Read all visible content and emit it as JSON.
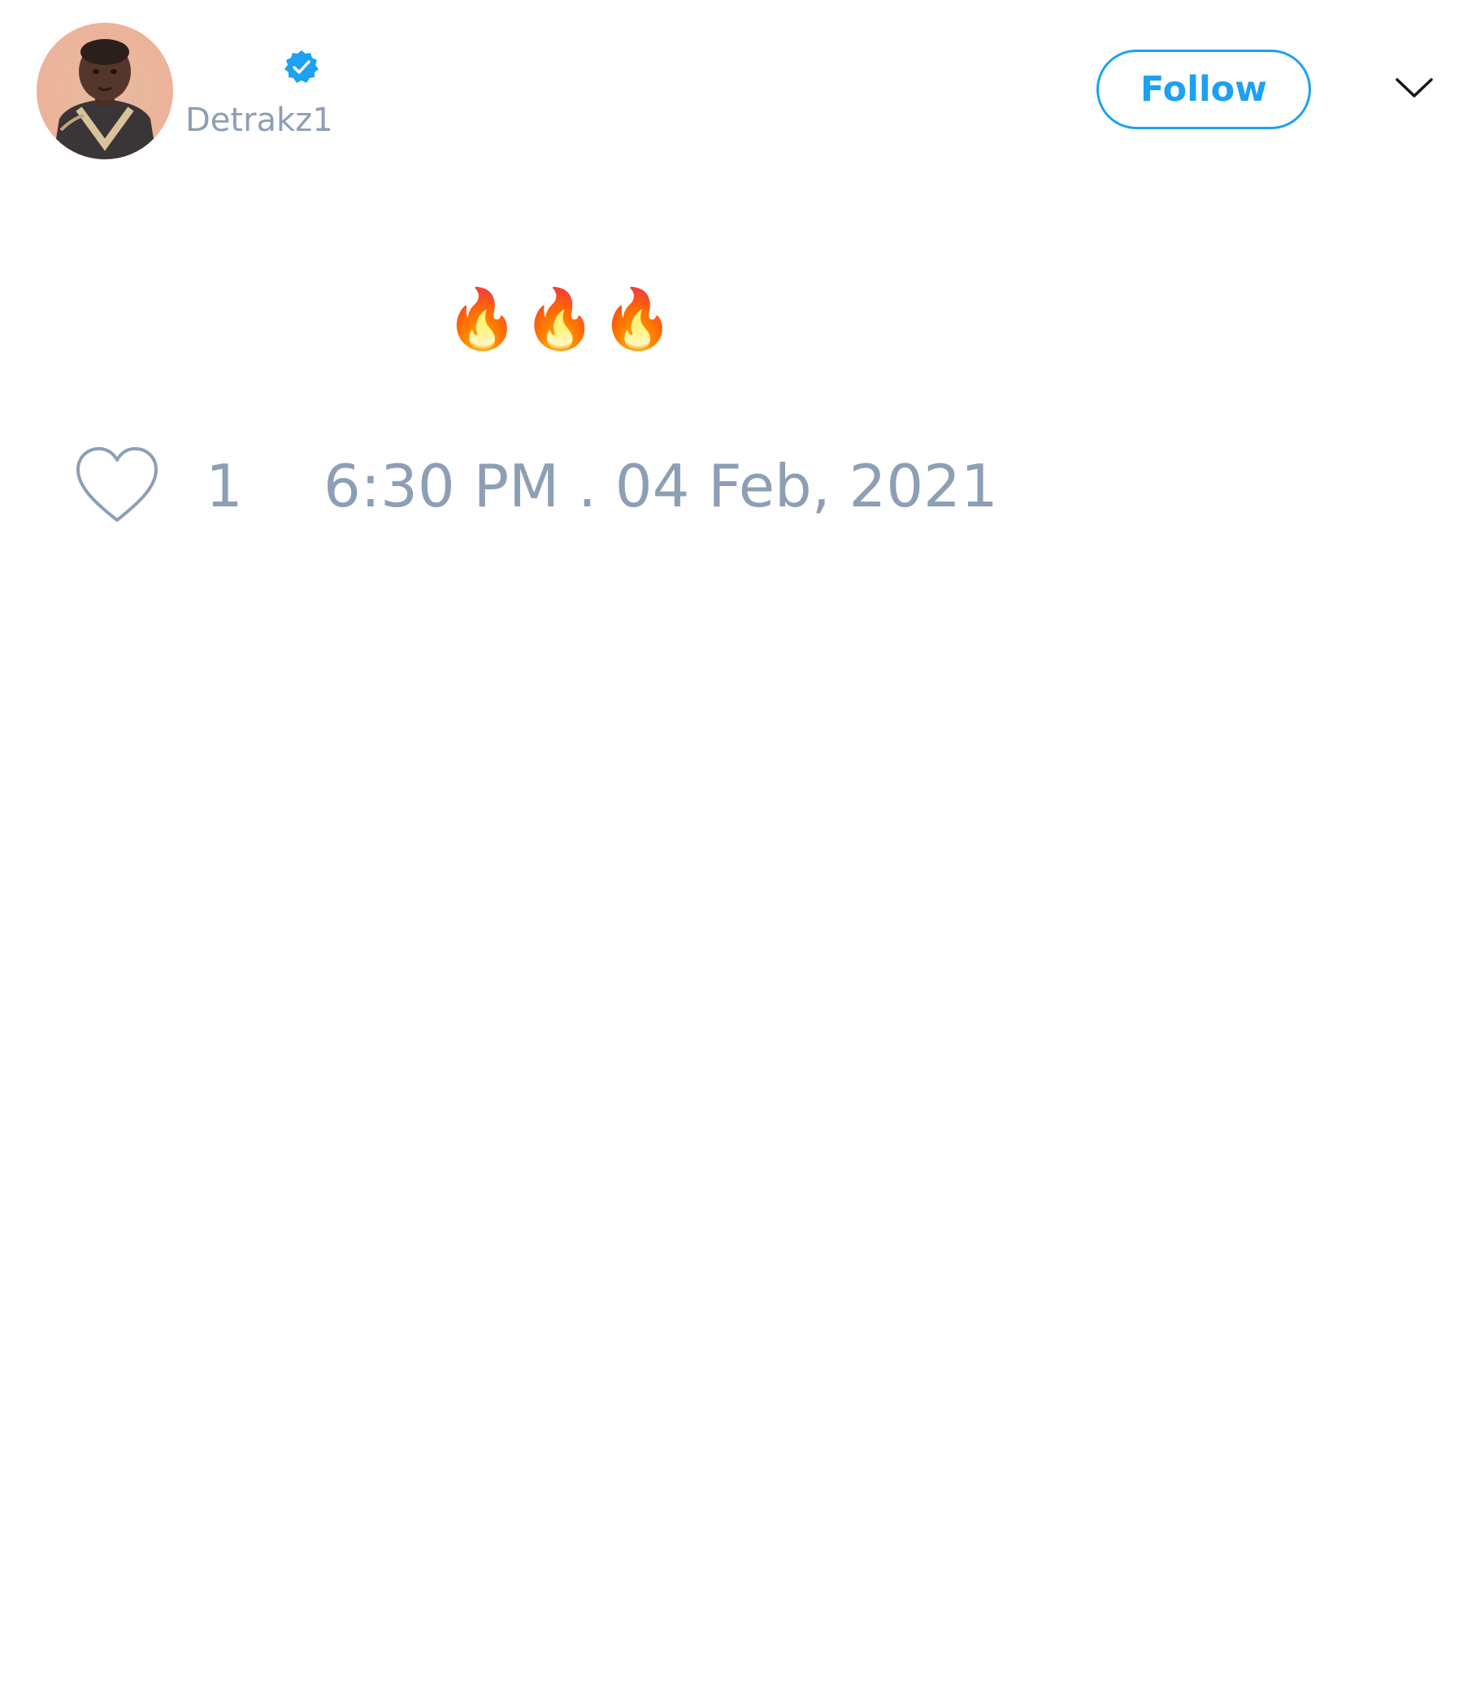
{
  "author": {
    "display_name": "",
    "handle": "Detrakz1",
    "verified": true,
    "avatar_icon": "profile-photo"
  },
  "actions": {
    "follow_label": "Follow",
    "menu_icon": "chevron-down-icon"
  },
  "tweet": {
    "text": "🔥🔥🔥"
  },
  "stats": {
    "like_icon": "heart-icon",
    "likes": "1",
    "timestamp": "6:30 PM . 04 Feb, 2021"
  },
  "colors": {
    "accent": "#1da1f2",
    "muted_text": "#8d9fb5",
    "background": "#ffffff"
  }
}
